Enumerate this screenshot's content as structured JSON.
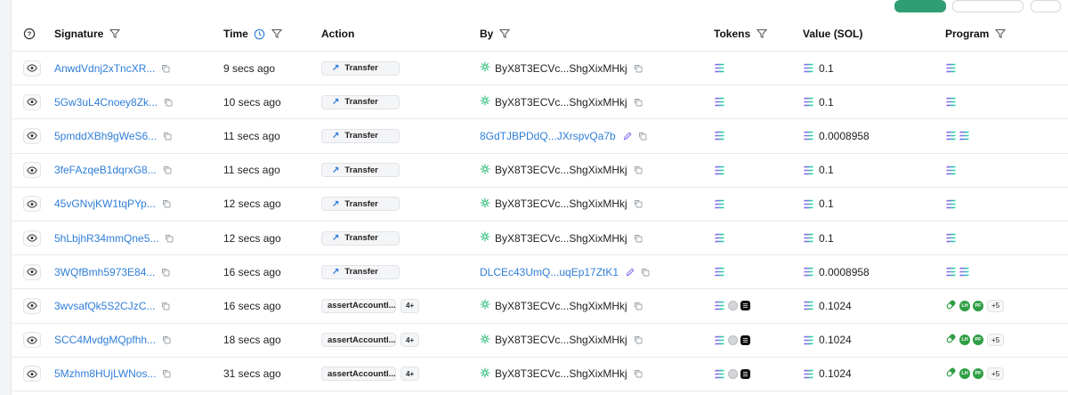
{
  "header": {
    "signature": "Signature",
    "time": "Time",
    "action": "Action",
    "by": "By",
    "tokens": "Tokens",
    "value": "Value (SOL)",
    "program": "Program"
  },
  "colors": {
    "link": "#2f7ed8",
    "green": "#2f9e74",
    "sol_gradient": [
      "#9945ff",
      "#14f195"
    ]
  },
  "rows": [
    {
      "signature": "AnwdVdnj2xTncXR...",
      "time": "9 secs ago",
      "action": "Transfer",
      "action_type": "transfer",
      "by": "ByX8T3ECVc...ShgXixMHkj",
      "by_type": "account",
      "tokens": "sol",
      "value": "0.1",
      "program": "sol"
    },
    {
      "signature": "5Gw3uL4Cnoey8Zk...",
      "time": "10 secs ago",
      "action": "Transfer",
      "action_type": "transfer",
      "by": "ByX8T3ECVc...ShgXixMHkj",
      "by_type": "account",
      "tokens": "sol",
      "value": "0.1",
      "program": "sol"
    },
    {
      "signature": "5pmddXBh9gWeS6...",
      "time": "11 secs ago",
      "action": "Transfer",
      "action_type": "transfer",
      "by": "8GdTJBPDdQ...JXrspvQa7b",
      "by_type": "link",
      "tokens": "sol",
      "value": "0.0008958",
      "program": "sol2"
    },
    {
      "signature": "3feFAzqeB1dqrxG8...",
      "time": "11 secs ago",
      "action": "Transfer",
      "action_type": "transfer",
      "by": "ByX8T3ECVc...ShgXixMHkj",
      "by_type": "account",
      "tokens": "sol",
      "value": "0.1",
      "program": "sol"
    },
    {
      "signature": "45vGNvjKW1tqPYp...",
      "time": "12 secs ago",
      "action": "Transfer",
      "action_type": "transfer",
      "by": "ByX8T3ECVc...ShgXixMHkj",
      "by_type": "account",
      "tokens": "sol",
      "value": "0.1",
      "program": "sol"
    },
    {
      "signature": "5hLbjhR34mmQne5...",
      "time": "12 secs ago",
      "action": "Transfer",
      "action_type": "transfer",
      "by": "ByX8T3ECVc...ShgXixMHkj",
      "by_type": "account",
      "tokens": "sol",
      "value": "0.1",
      "program": "sol"
    },
    {
      "signature": "3WQfBmh5973E84...",
      "time": "16 secs ago",
      "action": "Transfer",
      "action_type": "transfer",
      "by": "DLCEc43UmQ...uqEp17ZtK1",
      "by_type": "link",
      "tokens": "sol",
      "value": "0.0008958",
      "program": "sol2"
    },
    {
      "signature": "3wvsafQk5S2CJzC...",
      "time": "16 secs ago",
      "action": "assertAccountI...",
      "action_type": "assert",
      "more": "4+",
      "by": "ByX8T3ECVc...ShgXixMHkj",
      "by_type": "account",
      "tokens": "multi",
      "value": "0.1024",
      "program": "multi",
      "program_more": "+5",
      "badge_a": "LH",
      "badge_b": "PF"
    },
    {
      "signature": "SCC4MvdgMQpfhh...",
      "time": "18 secs ago",
      "action": "assertAccountI...",
      "action_type": "assert",
      "more": "4+",
      "by": "ByX8T3ECVc...ShgXixMHkj",
      "by_type": "account",
      "tokens": "multi",
      "value": "0.1024",
      "program": "multi",
      "program_more": "+5",
      "badge_a": "LH",
      "badge_b": "PF"
    },
    {
      "signature": "5Mzhm8HUjLWNos...",
      "time": "31 secs ago",
      "action": "assertAccountI...",
      "action_type": "assert",
      "more": "4+",
      "by": "ByX8T3ECVc...ShgXixMHkj",
      "by_type": "account",
      "tokens": "multi",
      "value": "0.1024",
      "program": "multi",
      "program_more": "+5",
      "badge_a": "LH",
      "badge_b": "PF"
    }
  ]
}
